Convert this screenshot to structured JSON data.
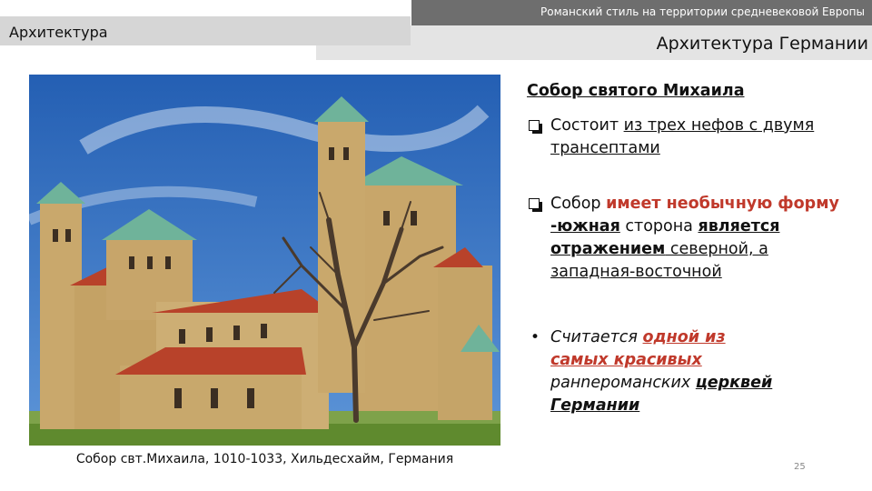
{
  "header": {
    "topbar_text": "Романский стиль на территории средневековой Европы",
    "section_label": "Архитектура",
    "slide_subtitle": "Архитектура Германии"
  },
  "photo_caption": "Собор свт.Михаила, 1010-1033, Хильдесхайм, Германия",
  "content": {
    "heading": "Собор святого Михаила",
    "item1": {
      "l1_plain": "Состоит ",
      "l1_link": "из трех нефов с двумя",
      "l2_link": "трансептами"
    },
    "item2": {
      "l1_plain": "Собор ",
      "l1_red": "имеет необычную форму",
      "l2_a": "-южная",
      "l2_b": " сторона ",
      "l2_c": "является",
      "l3_a": "отражением",
      "l3_b": " северной, а",
      "l4": "западная-восточной"
    },
    "item3": {
      "l1_plain": "Считается ",
      "l1_red": "одной из",
      "l2_red": "самых красивых",
      "l3_plain": "ранneроманских ",
      "l3_u": "церквей",
      "l4": "Германии"
    }
  },
  "page_number": "25",
  "colors": {
    "sky": "#2f6fc3",
    "roof_red": "#b8422a",
    "roof_green": "#6fb39a",
    "stone": "#c9a86c",
    "accent_red": "#c0392b"
  }
}
